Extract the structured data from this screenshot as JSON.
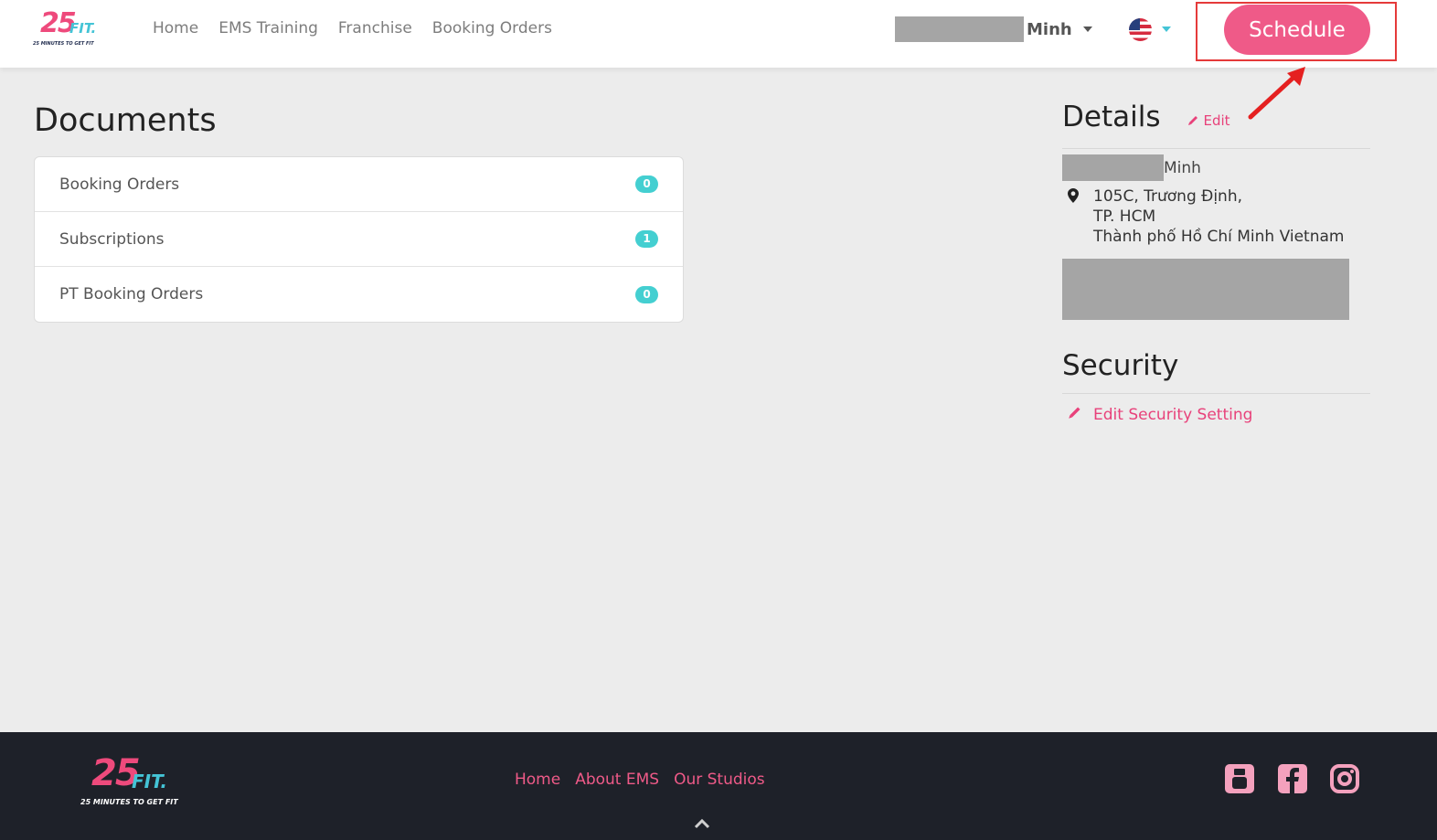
{
  "brand": {
    "logo_number": "25",
    "logo_word": "FIT.",
    "logo_tagline": "25 MINUTES TO GET FIT",
    "accent": "#ef5a88",
    "teal": "#44c4d6"
  },
  "nav": {
    "items": [
      "Home",
      "EMS Training",
      "Franchise",
      "Booking Orders"
    ]
  },
  "user": {
    "name": "Minh"
  },
  "language": {
    "icon": "us-flag-icon"
  },
  "schedule": {
    "label": "Schedule"
  },
  "documents": {
    "title": "Documents",
    "rows": [
      {
        "label": "Booking Orders",
        "count": "0"
      },
      {
        "label": "Subscriptions",
        "count": "1"
      },
      {
        "label": "PT Booking Orders",
        "count": "0"
      }
    ]
  },
  "details": {
    "title": "Details",
    "edit_label": "Edit",
    "name": "Minh",
    "address_line1": "105C, Trương Định,",
    "address_line2": "TP. HCM",
    "address_line3": "Thành phố Hồ Chí Minh Vietnam"
  },
  "security": {
    "title": "Security",
    "edit_label": "Edit Security Setting"
  },
  "footer": {
    "links": [
      "Home",
      "About EMS",
      "Our Studios"
    ],
    "social": [
      "youtube-icon",
      "facebook-icon",
      "instagram-icon"
    ]
  }
}
